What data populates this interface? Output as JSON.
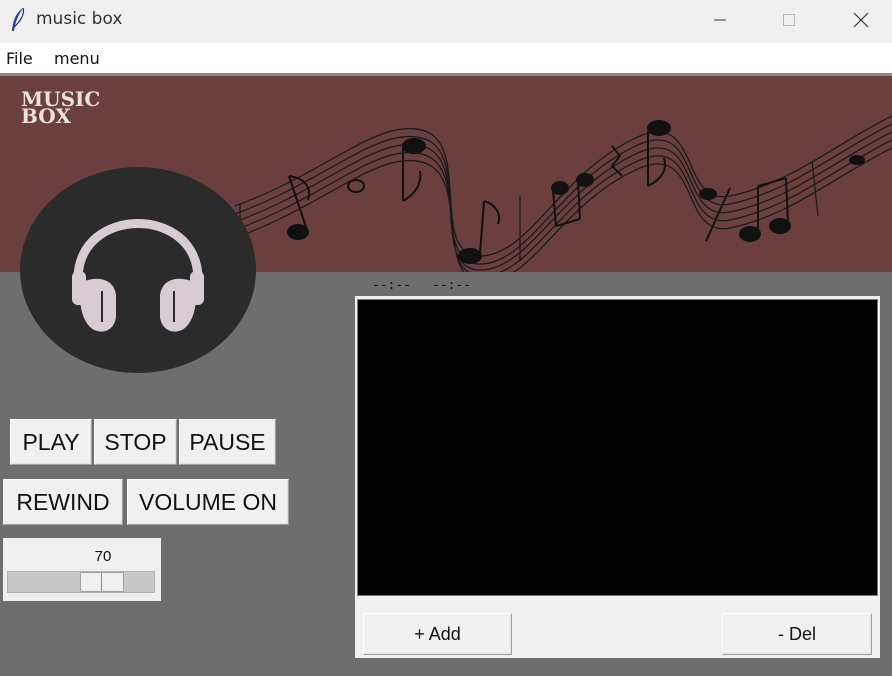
{
  "window": {
    "title": "music box",
    "minimize_label": "—",
    "maximize_label": "☐",
    "close_label": "✕"
  },
  "menubar": {
    "items": [
      "File",
      "menu"
    ]
  },
  "banner": {
    "logo_line1": "MUSIC",
    "logo_line2": "BOX"
  },
  "controls": {
    "play": "PLAY",
    "stop": "STOP",
    "pause": "PAUSE",
    "rewind": "REWIND",
    "volume": "VOLUME ON"
  },
  "volume_scale": {
    "value": "70"
  },
  "time": {
    "elapsed": "--:--",
    "total": "--:--"
  },
  "playlist": {
    "items": [],
    "add_label": "+ Add",
    "del_label": "- Del"
  },
  "colors": {
    "banner": "#6b3f3f",
    "main_bg": "#6e6e6e",
    "disc": "#2b2b2b",
    "headphones": "#d8ccd4",
    "playlist_bg": "#000000"
  }
}
